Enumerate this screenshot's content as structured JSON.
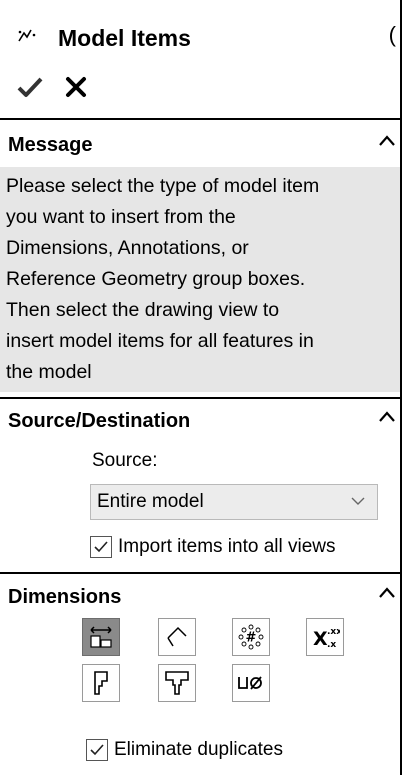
{
  "header": {
    "title": "Model Items",
    "title_icon": "model-items-icon",
    "help_glyph": "("
  },
  "actions": {
    "ok_icon": "checkmark-icon",
    "cancel_icon": "x-close-icon"
  },
  "message": {
    "heading": "Message",
    "lines": [
      "Please select the type of model item",
      "you want to insert from the",
      "Dimensions, Annotations, or",
      "Reference Geometry group boxes.",
      "Then select the drawing view  to",
      "insert model items for all features in",
      "the model"
    ]
  },
  "source_destination": {
    "heading": "Source/Destination",
    "source_label": "Source:",
    "source_value": "Entire model",
    "import_all_label": "Import items into all views",
    "import_all_checked": true
  },
  "dimensions": {
    "heading": "Dimensions",
    "tools": [
      {
        "name": "marked-for-drawing",
        "icon": "marked-for-drawing-icon",
        "active": true
      },
      {
        "name": "not-marked-for-drawing",
        "icon": "not-marked-for-drawing-icon",
        "active": false
      },
      {
        "name": "instance-count",
        "icon": "instance-count-icon",
        "active": false,
        "glyph": "#"
      },
      {
        "name": "tolerance-dimensions",
        "icon": "tolerance-dimensions-icon",
        "active": false,
        "glyph": "X",
        "sup": "xx",
        "sub": ".x"
      },
      {
        "name": "hole-wizard-profiles",
        "icon": "hole-wizard-profiles-icon",
        "active": false
      },
      {
        "name": "hole-wizard-locations",
        "icon": "hole-wizard-locations-icon",
        "active": false
      },
      {
        "name": "hole-callout",
        "icon": "hole-callout-icon",
        "active": false,
        "glyph": "⊔Ø"
      }
    ],
    "eliminate_duplicates_label": "Eliminate duplicates",
    "eliminate_duplicates_checked": true
  },
  "colors": {
    "message_bg": "#e6e6e6",
    "dropdown_bg": "#ececec",
    "active_tool_bg": "#8a8a8a"
  }
}
